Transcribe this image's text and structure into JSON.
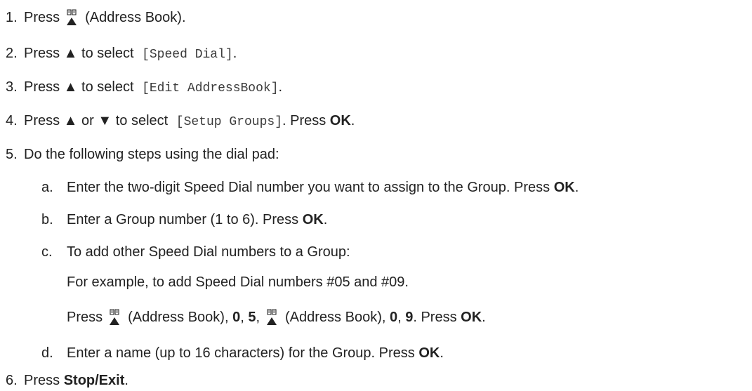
{
  "steps": [
    {
      "num": "1.",
      "pre": "Press",
      "post": "(Address Book)."
    },
    {
      "num": "2.",
      "pre": "Press ▲ to select",
      "code": "[Speed Dial]",
      "post": "."
    },
    {
      "num": "3.",
      "pre": "Press ▲ to select",
      "code": "[Edit AddressBook]",
      "post": "."
    },
    {
      "num": "4.",
      "pre": "Press ▲ or ▼ to select",
      "code": "[Setup Groups]",
      "mid": ". Press",
      "bold": "OK",
      "post": "."
    },
    {
      "num": "5.",
      "text": "Do the following steps using the dial pad:"
    },
    {
      "num": "6.",
      "pre": "Press",
      "bold": "Stop/Exit",
      "post": "."
    }
  ],
  "substeps": [
    {
      "letter": "a.",
      "text": "Enter the two-digit Speed Dial number you want to assign to the Group. Press",
      "bold": "OK",
      "post": "."
    },
    {
      "letter": "b.",
      "text": "Enter a Group number (1 to 6). Press",
      "bold": "OK",
      "post": "."
    },
    {
      "letter": "c.",
      "text": "To add other Speed Dial numbers to a Group:"
    },
    {
      "letter": "d.",
      "text": "Enter a name (up to 16 characters) for the Group. Press",
      "bold": "OK",
      "post": "."
    }
  ],
  "example": {
    "line1": "For example, to add Speed Dial numbers #05 and #09.",
    "press": "Press",
    "ab1": "(Address Book),",
    "d1": "0",
    "comma1": ",",
    "d2": "5",
    "comma2": ",",
    "ab2": "(Address Book),",
    "d3": "0",
    "comma3": ",",
    "d4": "9",
    "tail": ". Press",
    "ok": "OK",
    "end": "."
  },
  "icons": {
    "address_book": "address-book-icon"
  }
}
